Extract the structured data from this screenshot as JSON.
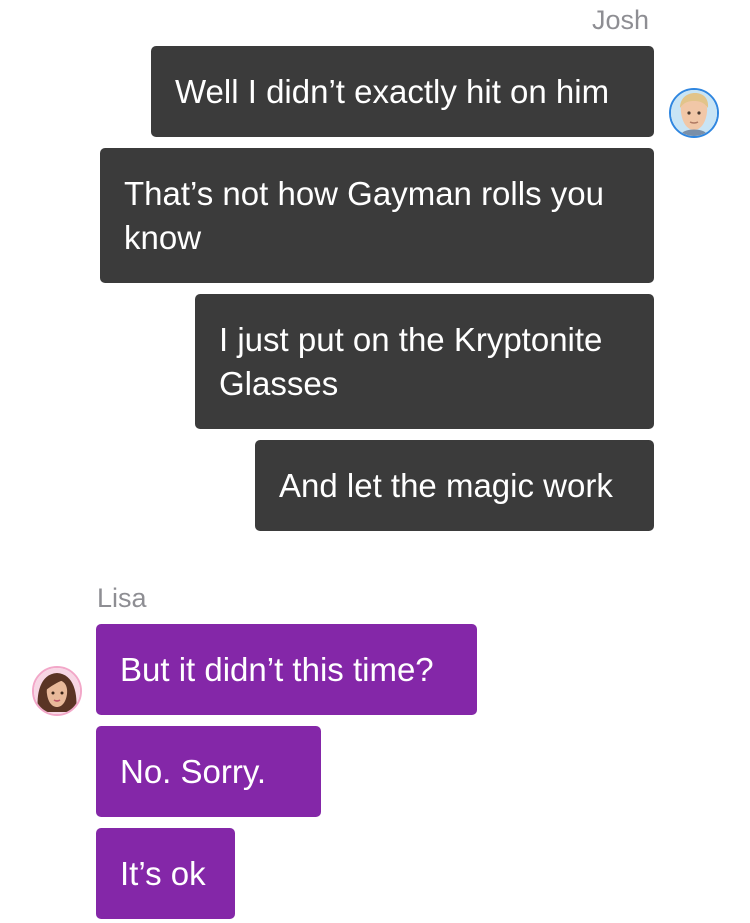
{
  "chat": {
    "outgoing_sender": "Josh",
    "incoming_sender": "Lisa",
    "outgoing_messages": [
      {
        "line1": "Well I didn’t exactly hit on him",
        "line2": ""
      },
      {
        "line1": "That’s not how Gayman rolls you",
        "line2": "know"
      },
      {
        "line1": "I just put on the Kryptonite",
        "line2": "Glasses"
      },
      {
        "line1": "And let the magic work",
        "line2": ""
      }
    ],
    "incoming_messages": [
      {
        "text": "But it didn’t this time?"
      },
      {
        "text": "No. Sorry."
      },
      {
        "text": "It’s ok"
      }
    ],
    "colors": {
      "outgoing_bubble": "#3b3b3b",
      "incoming_bubble": "#8427a8",
      "sender_name": "#8e8e93"
    },
    "avatars": {
      "outgoing": "josh-avatar-icon",
      "incoming": "lisa-avatar-icon"
    }
  }
}
